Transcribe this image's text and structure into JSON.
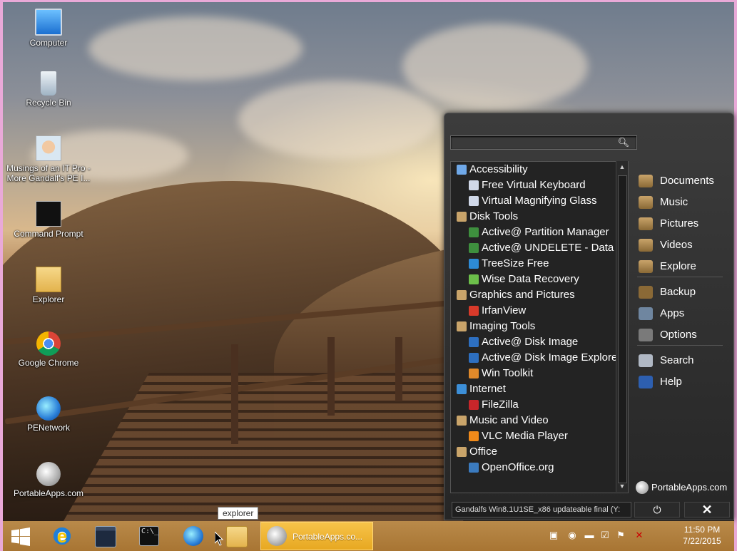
{
  "desktop_icons": [
    {
      "label": "Computer",
      "icon": "computer-icon"
    },
    {
      "label": "Recycle Bin",
      "icon": "recycle-bin-icon"
    },
    {
      "label": "Musings of an IT Pro -\nMore Gandalf's PE I...",
      "icon": "avatar-icon"
    },
    {
      "label": "Command Prompt",
      "icon": "command-prompt-icon"
    },
    {
      "label": "Explorer",
      "icon": "folder-icon"
    },
    {
      "label": "Google Chrome",
      "icon": "chrome-icon"
    },
    {
      "label": "PENetwork",
      "icon": "network-icon"
    },
    {
      "label": "PortableApps.com",
      "icon": "portableapps-icon"
    }
  ],
  "menu": {
    "search_placeholder": "",
    "list": [
      {
        "type": "cat",
        "label": "Accessibility",
        "color": "#6fa8e8"
      },
      {
        "type": "app",
        "label": "Free Virtual Keyboard",
        "color": "#d0d8e8"
      },
      {
        "type": "app",
        "label": "Virtual Magnifying Glass",
        "color": "#d0d8e8"
      },
      {
        "type": "cat",
        "label": "Disk Tools",
        "color": "#c9a46a"
      },
      {
        "type": "app",
        "label": "Active@ Partition Manager",
        "color": "#3e8f3e"
      },
      {
        "type": "app",
        "label": "Active@ UNDELETE - Data R",
        "color": "#3e8f3e"
      },
      {
        "type": "app",
        "label": "TreeSize Free",
        "color": "#2d8bd6"
      },
      {
        "type": "app",
        "label": "Wise Data Recovery",
        "color": "#6cbf4a"
      },
      {
        "type": "cat",
        "label": "Graphics and Pictures",
        "color": "#c9a46a"
      },
      {
        "type": "app",
        "label": "IrfanView",
        "color": "#d83a2a"
      },
      {
        "type": "cat",
        "label": "Imaging Tools",
        "color": "#c9a46a"
      },
      {
        "type": "app",
        "label": "Active@ Disk Image",
        "color": "#2d6fc0"
      },
      {
        "type": "app",
        "label": "Active@ Disk Image Explore",
        "color": "#2d6fc0"
      },
      {
        "type": "app",
        "label": "Win Toolkit",
        "color": "#e0892a"
      },
      {
        "type": "cat",
        "label": "Internet",
        "color": "#3c8fd8"
      },
      {
        "type": "app",
        "label": "FileZilla",
        "color": "#c8262a"
      },
      {
        "type": "cat",
        "label": "Music and Video",
        "color": "#c9a46a"
      },
      {
        "type": "app",
        "label": "VLC Media Player",
        "color": "#f08a1a"
      },
      {
        "type": "cat",
        "label": "Office",
        "color": "#c9a46a"
      },
      {
        "type": "app",
        "label": "OpenOffice.org",
        "color": "#3b7bbf"
      }
    ],
    "links": [
      {
        "label": "Documents",
        "icon": "documents-folder-icon"
      },
      {
        "label": "Music",
        "icon": "music-folder-icon"
      },
      {
        "label": "Pictures",
        "icon": "pictures-folder-icon"
      },
      {
        "label": "Videos",
        "icon": "videos-folder-icon"
      },
      {
        "label": "Explore",
        "icon": "explore-folder-icon"
      },
      {
        "label": "Backup",
        "icon": "backup-icon"
      },
      {
        "label": "Apps",
        "icon": "apps-icon"
      },
      {
        "label": "Options",
        "icon": "options-icon"
      },
      {
        "label": "Search",
        "icon": "search-icon"
      },
      {
        "label": "Help",
        "icon": "help-icon"
      }
    ],
    "brand": "PortableApps.com",
    "status": "Gandalfs Win8.1U1SE_x86 updateable final (Y:",
    "power_glyph": "⏻",
    "close_glyph": "✕"
  },
  "tooltip": "explorer",
  "taskbar": {
    "active_label": "PortableApps.co...",
    "time": "11:50 PM",
    "date": "7/22/2015"
  }
}
